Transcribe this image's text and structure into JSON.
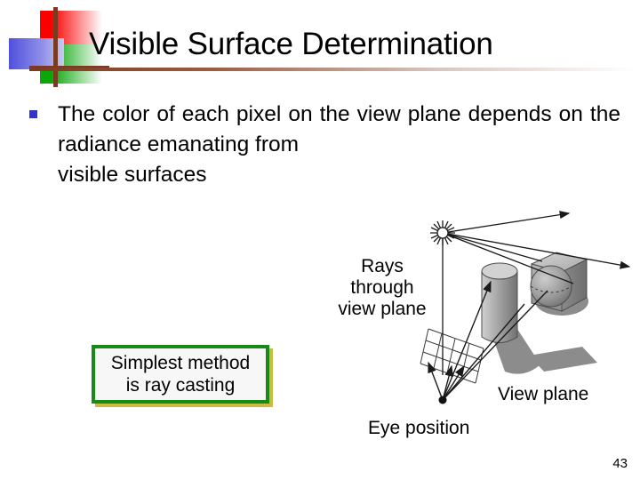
{
  "slide": {
    "title": "Visible Surface Determination",
    "page_number": "43",
    "bullet": {
      "marker": "square-bullet",
      "text": "The color of each pixel on the view plane depends on the radiance emanating from",
      "last_line": "visible surfaces"
    },
    "callout": {
      "line1": "Simplest method",
      "line2": "is ray casting",
      "border_color": "#178a17",
      "shadow_color": "#c9bc3e",
      "fill_color": "#f7f7f7"
    },
    "labels": {
      "rays_line1": "Rays",
      "rays_line2": "through",
      "rays_line3": "view plane",
      "view_plane": "View plane",
      "eye_position": "Eye position"
    },
    "colors": {
      "title_text": "#000000",
      "bullet_marker": "#3333cc",
      "rule": "#7a3b21",
      "logo_red": "#fb0000",
      "logo_green": "#0aa60a",
      "logo_blue": "#5050dd",
      "background": "#ffffff"
    },
    "diagram": {
      "name": "ray-casting-diagram",
      "elements": {
        "light_source": "starburst",
        "view_plane_grid": "skewed-grid",
        "eye_point": "black-dot",
        "objects": [
          "cube",
          "cylinder",
          "sphere"
        ],
        "shadows": 3,
        "rays_from_eye": 4,
        "rays_from_light": 5
      }
    }
  }
}
